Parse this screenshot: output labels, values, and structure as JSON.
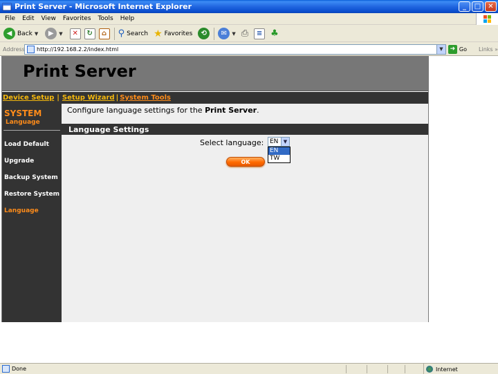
{
  "window": {
    "title": "Print Server - Microsoft Internet Explorer"
  },
  "menu": {
    "items": [
      "File",
      "Edit",
      "View",
      "Favorites",
      "Tools",
      "Help"
    ]
  },
  "toolbar": {
    "back_label": "Back",
    "search_label": "Search",
    "favorites_label": "Favorites"
  },
  "address": {
    "label": "Address",
    "url": "http://192.168.2.2/index.html",
    "go_label": "Go",
    "links_label": "Links"
  },
  "page": {
    "header_title": "Print Server",
    "nav": {
      "device_setup": "Device Setup",
      "setup_wizard": "Setup Wizard",
      "system_tools": "System Tools",
      "separator": "|"
    },
    "sidebar": {
      "heading": "SYSTEM",
      "subheading": "Language",
      "items": [
        "Load Default",
        "Upgrade",
        "Backup System",
        "Restore System",
        "Language"
      ]
    },
    "main": {
      "desc_prefix": "Configure language settings for the ",
      "desc_bold": "Print Server",
      "desc_suffix": ".",
      "section_title": "Language Settings",
      "select_label": "Select language:",
      "select_value": "EN",
      "options": [
        "EN",
        "TW"
      ],
      "ok_label": "OK"
    }
  },
  "status": {
    "text": "Done",
    "zone": "Internet"
  },
  "colors": {
    "accent_orange": "#ff8c1a",
    "nav_yellow": "#f5b80d",
    "header_gray": "#777777",
    "dark_panel": "#333333"
  }
}
